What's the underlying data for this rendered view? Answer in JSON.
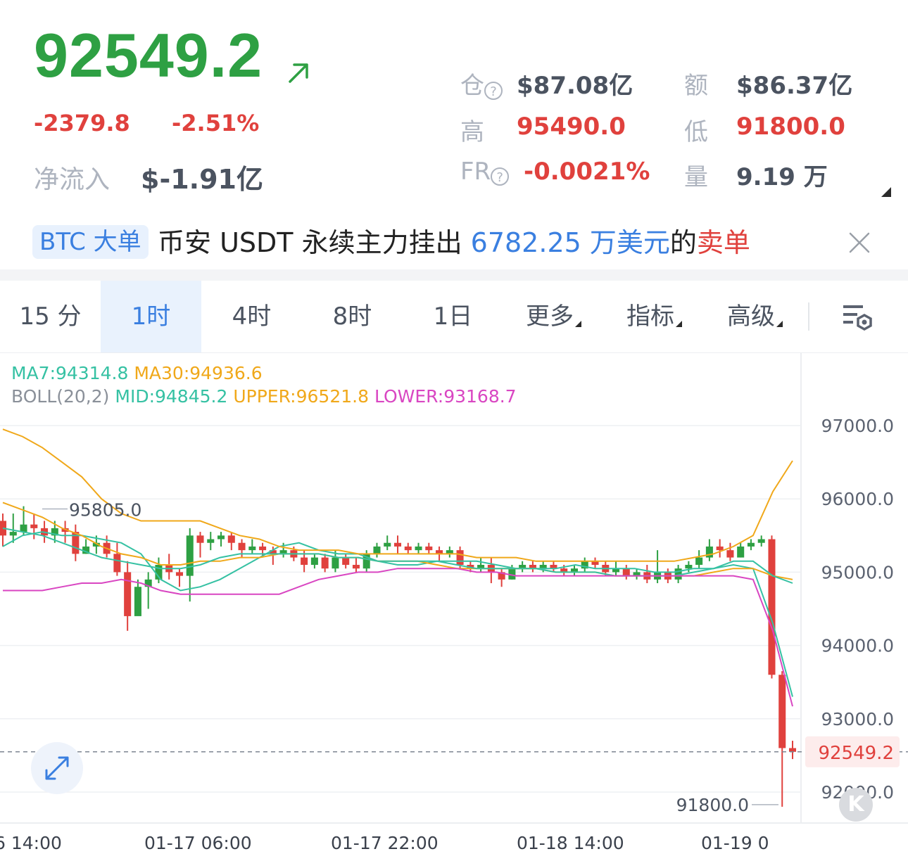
{
  "ticker": {
    "last_price": "92549.2",
    "change": "-2379.8",
    "change_pct": "-2.51%",
    "net_inflow_label": "净流入",
    "net_inflow_value": "$-1.91亿"
  },
  "stats": {
    "open_interest_label": "仓",
    "open_interest_value": "$87.08亿",
    "turnover_label": "额",
    "turnover_value": "$86.37亿",
    "high_label": "高",
    "high_value": "95490.0",
    "low_label": "低",
    "low_value": "91800.0",
    "funding_rate_label": "FR",
    "funding_rate_value": "-0.0021%",
    "volume_label": "量",
    "volume_value": "9.19 万"
  },
  "news": {
    "tag": "BTC 大单",
    "text_prefix": "币安 USDT 永续主力挂出 ",
    "amount": "6782.25 万美元",
    "text_mid": "的",
    "side": "卖单"
  },
  "timeframe_tabs": [
    {
      "label": "15 分"
    },
    {
      "label": "1时",
      "active": true
    },
    {
      "label": "4时"
    },
    {
      "label": "8时"
    },
    {
      "label": "1日"
    },
    {
      "label": "更多"
    },
    {
      "label": "指标"
    },
    {
      "label": "高级"
    }
  ],
  "indicators": {
    "ma7": "MA7:94314.8",
    "ma30": "MA30:94936.6",
    "boll": "BOLL(20,2)",
    "mid": "MID:94845.2",
    "upper": "UPPER:96521.8",
    "lower": "LOWER:93168.7"
  },
  "colors": {
    "up": "#2ea043",
    "down": "#e0413d",
    "ma7": "#35c1a3",
    "ma30": "#f0a81a",
    "boll_mid": "#35c1a3",
    "boll_upper": "#f0a81a",
    "boll_lower": "#d946c2",
    "accent": "#3a7fe0"
  },
  "chart_data": {
    "type": "candlestick",
    "y_ticks": [
      "97000.0",
      "96000.0",
      "95000.0",
      "94000.0",
      "93000.0",
      "92000.0"
    ],
    "x_ticks": [
      "6 14:00",
      "01-17 06:00",
      "01-17 22:00",
      "01-18 14:00",
      "01-19 0"
    ],
    "ylim": [
      91600,
      97500
    ],
    "current_price_label": "92549.2",
    "annotations": {
      "high": "95805.0",
      "low": "91800.0"
    },
    "candles": [
      [
        95700,
        95500,
        95800,
        95350
      ],
      [
        95500,
        95550,
        95800,
        95400
      ],
      [
        95550,
        95650,
        95900,
        95500
      ],
      [
        95650,
        95600,
        95800,
        95450
      ],
      [
        95600,
        95500,
        95700,
        95400
      ],
      [
        95500,
        95600,
        95700,
        95400
      ],
      [
        95600,
        95550,
        95700,
        95400
      ],
      [
        95550,
        95250,
        95650,
        95150
      ],
      [
        95250,
        95350,
        95450,
        95250
      ],
      [
        95350,
        95400,
        95500,
        95250
      ],
      [
        95400,
        95250,
        95500,
        95200
      ],
      [
        95250,
        95000,
        95400,
        94950
      ],
      [
        95000,
        94400,
        95150,
        94200
      ],
      [
        94400,
        94800,
        94900,
        94450
      ],
      [
        94800,
        94900,
        95000,
        94500
      ],
      [
        94900,
        95100,
        95200,
        94850
      ],
      [
        95100,
        95000,
        95250,
        94900
      ],
      [
        95000,
        94950,
        95050,
        94800
      ],
      [
        94950,
        95500,
        95600,
        94600
      ],
      [
        95500,
        95400,
        95550,
        95200
      ],
      [
        95400,
        95450,
        95550,
        95300
      ],
      [
        95450,
        95500,
        95550,
        95350
      ],
      [
        95500,
        95400,
        95550,
        95300
      ],
      [
        95400,
        95300,
        95450,
        95200
      ],
      [
        95300,
        95350,
        95450,
        95250
      ],
      [
        95350,
        95300,
        95400,
        95200
      ],
      [
        95300,
        95250,
        95350,
        95100
      ],
      [
        95250,
        95300,
        95400,
        95200
      ],
      [
        95300,
        95200,
        95350,
        95150
      ],
      [
        95200,
        95100,
        95300,
        95000
      ],
      [
        95100,
        95200,
        95250,
        95050
      ],
      [
        95200,
        95050,
        95250,
        95000
      ],
      [
        95050,
        95200,
        95300,
        95000
      ],
      [
        95200,
        95100,
        95250,
        95050
      ],
      [
        95100,
        95050,
        95200,
        95000
      ],
      [
        95050,
        95250,
        95300,
        95000
      ],
      [
        95250,
        95350,
        95400,
        95200
      ],
      [
        95350,
        95400,
        95500,
        95300
      ],
      [
        95400,
        95350,
        95500,
        95250
      ],
      [
        95350,
        95300,
        95400,
        95250
      ],
      [
        95300,
        95350,
        95400,
        95250
      ],
      [
        95350,
        95300,
        95400,
        95250
      ],
      [
        95300,
        95250,
        95350,
        95150
      ],
      [
        95250,
        95300,
        95350,
        95200
      ],
      [
        95300,
        95100,
        95350,
        95050
      ],
      [
        95100,
        95050,
        95150,
        95000
      ],
      [
        95050,
        95100,
        95200,
        95000
      ],
      [
        95100,
        95000,
        95200,
        94850
      ],
      [
        95000,
        94900,
        95050,
        94800
      ],
      [
        94900,
        95050,
        95100,
        94900
      ],
      [
        95050,
        95100,
        95150,
        95000
      ],
      [
        95100,
        95050,
        95150,
        95000
      ],
      [
        95050,
        95100,
        95150,
        95000
      ],
      [
        95100,
        95050,
        95150,
        95000
      ],
      [
        95050,
        95000,
        95100,
        94950
      ],
      [
        95000,
        95050,
        95100,
        94950
      ],
      [
        95050,
        95150,
        95200,
        95000
      ],
      [
        95150,
        95100,
        95200,
        95050
      ],
      [
        95100,
        95000,
        95150,
        94950
      ],
      [
        95000,
        95050,
        95150,
        94950
      ],
      [
        95050,
        94950,
        95100,
        94900
      ],
      [
        94950,
        95000,
        95050,
        94900
      ],
      [
        95000,
        94900,
        95100,
        94850
      ],
      [
        94900,
        95000,
        95300,
        94850
      ],
      [
        95000,
        94900,
        95050,
        94850
      ],
      [
        94900,
        95050,
        95100,
        94850
      ],
      [
        95050,
        95100,
        95150,
        95000
      ],
      [
        95100,
        95200,
        95300,
        95050
      ],
      [
        95200,
        95350,
        95450,
        95150
      ],
      [
        95350,
        95300,
        95450,
        95200
      ],
      [
        95300,
        95200,
        95400,
        95150
      ],
      [
        95200,
        95350,
        95400,
        95200
      ],
      [
        95350,
        95400,
        95450,
        95300
      ],
      [
        95400,
        95450,
        95500,
        95350
      ],
      [
        95450,
        93600,
        95500,
        93550
      ],
      [
        93600,
        92600,
        93650,
        91800
      ],
      [
        92600,
        92549.2,
        92700,
        92450
      ]
    ],
    "series": [
      {
        "name": "MA7",
        "values": [
          95350,
          95500,
          95550,
          95500,
          95500,
          95450,
          95400,
          95250,
          94900,
          94750,
          94800,
          94900,
          95050,
          95200,
          95350,
          95400,
          95300,
          95250,
          95250,
          95150,
          95100,
          95100,
          95150,
          95150,
          95150,
          95100,
          95050,
          95050,
          95050,
          95100,
          95050,
          95050,
          95050,
          95000,
          95000,
          95050,
          95050,
          95100,
          95050,
          94300,
          93300
        ]
      },
      {
        "name": "MA30",
        "values": [
          95950,
          95850,
          95750,
          95600,
          95500,
          95350,
          95250,
          95200,
          95100,
          95100,
          95150,
          95150,
          95200,
          95200,
          95250,
          95250,
          95250,
          95200,
          95200,
          95150,
          95150,
          95150,
          95100,
          95050,
          95050,
          95050,
          95050,
          95050,
          95000,
          95000,
          95000,
          94950,
          94950,
          94950,
          94950,
          94950,
          95000,
          95050,
          95050,
          94950,
          94900
        ]
      },
      {
        "name": "MID",
        "values": [
          95600,
          95550,
          95500,
          95400,
          95300,
          95200,
          95150,
          95100,
          95050,
          95050,
          95100,
          95200,
          95250,
          95250,
          95250,
          95250,
          95250,
          95200,
          95200,
          95150,
          95150,
          95150,
          95150,
          95100,
          95050,
          95050,
          95050,
          95050,
          95000,
          95000,
          95000,
          94950,
          94950,
          94950,
          94950,
          95000,
          95050,
          95150,
          95150,
          94950,
          94850
        ]
      },
      {
        "name": "UPPER",
        "values": [
          96950,
          96850,
          96700,
          96500,
          96300,
          96000,
          95800,
          95700,
          95700,
          95700,
          95700,
          95600,
          95500,
          95450,
          95350,
          95300,
          95300,
          95300,
          95250,
          95250,
          95250,
          95250,
          95250,
          95250,
          95200,
          95200,
          95200,
          95150,
          95150,
          95150,
          95150,
          95150,
          95150,
          95150,
          95150,
          95200,
          95250,
          95350,
          95500,
          96100,
          96520
        ]
      },
      {
        "name": "LOWER",
        "values": [
          94750,
          94750,
          94750,
          94800,
          94850,
          94850,
          94900,
          94850,
          94750,
          94700,
          94700,
          94700,
          94700,
          94700,
          94700,
          94800,
          94900,
          94950,
          95000,
          95000,
          95050,
          95050,
          95050,
          95050,
          95000,
          95000,
          94950,
          94950,
          94950,
          94950,
          94950,
          94950,
          94950,
          94950,
          94950,
          94950,
          94950,
          94950,
          94900,
          94200,
          93170
        ]
      }
    ]
  }
}
